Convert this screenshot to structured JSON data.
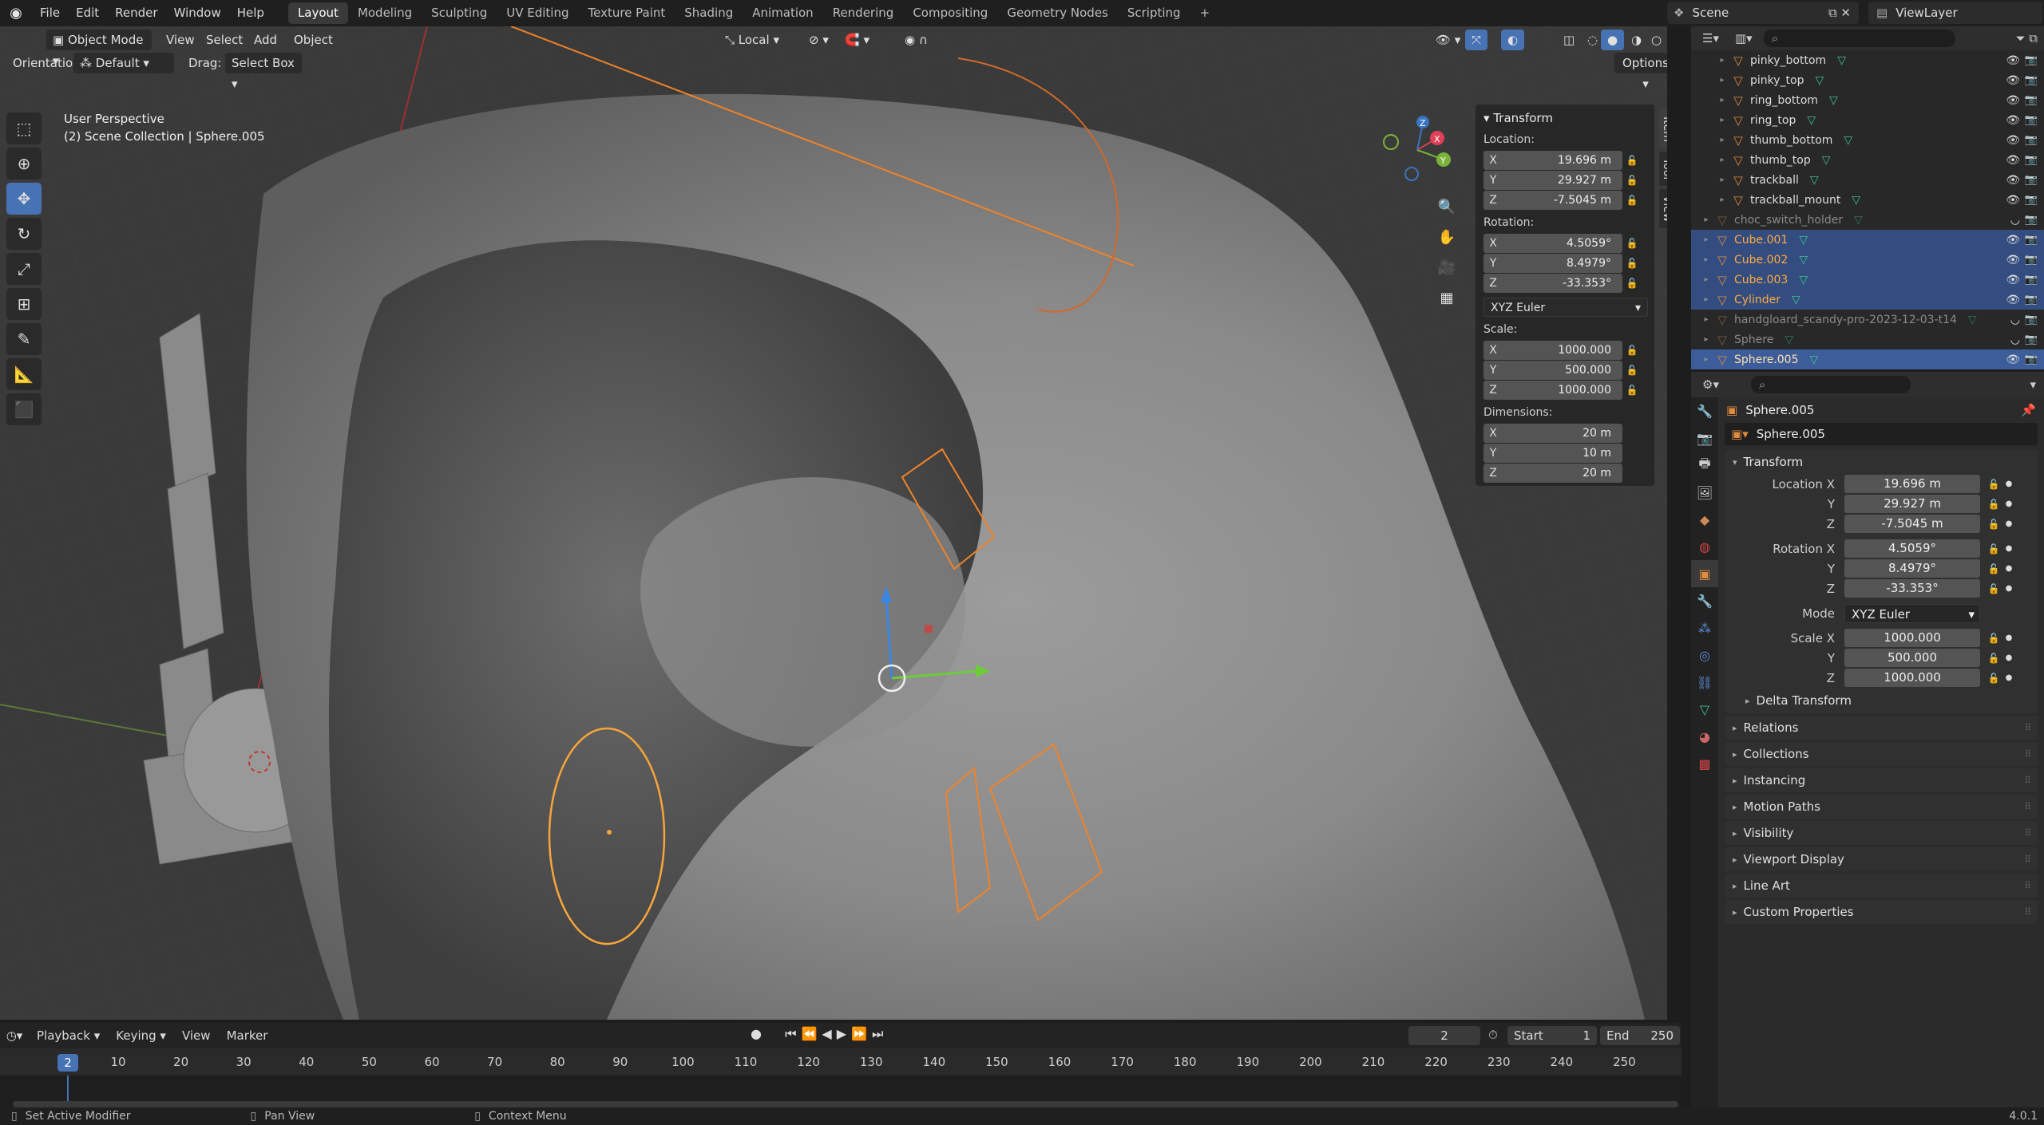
{
  "menu": [
    "File",
    "Edit",
    "Render",
    "Window",
    "Help"
  ],
  "workspaces": [
    "Layout",
    "Modeling",
    "Sculpting",
    "UV Editing",
    "Texture Paint",
    "Shading",
    "Animation",
    "Rendering",
    "Compositing",
    "Geometry Nodes",
    "Scripting"
  ],
  "active_workspace": "Layout",
  "add_workspace_icon": "+",
  "scene": "Scene",
  "view_layer": "ViewLayer",
  "viewport": {
    "mode": "Object Mode",
    "menus": [
      "View",
      "Select",
      "Add",
      "Object"
    ],
    "orientation_label": "Orientation:",
    "orientation_value": "Default",
    "drag_label": "Drag:",
    "drag_value": "Select Box",
    "transform_space": "Local",
    "options": "Options",
    "perspective": "User Perspective",
    "collection_path": "(2) Scene Collection | Sphere.005",
    "gizmo_axes": {
      "x": "X",
      "y": "Y",
      "z": "Z"
    }
  },
  "npanel": {
    "header": "Transform",
    "location_label": "Location:",
    "location": [
      {
        "axis": "X",
        "value": "19.696 m"
      },
      {
        "axis": "Y",
        "value": "29.927 m"
      },
      {
        "axis": "Z",
        "value": "-7.5045 m"
      }
    ],
    "rotation_label": "Rotation:",
    "rotation": [
      {
        "axis": "X",
        "value": "4.5059°"
      },
      {
        "axis": "Y",
        "value": "8.4979°"
      },
      {
        "axis": "Z",
        "value": "-33.353°"
      }
    ],
    "rotation_mode": "XYZ Euler",
    "scale_label": "Scale:",
    "scale": [
      {
        "axis": "X",
        "value": "1000.000"
      },
      {
        "axis": "Y",
        "value": "500.000"
      },
      {
        "axis": "Z",
        "value": "1000.000"
      }
    ],
    "dimensions_label": "Dimensions:",
    "dimensions": [
      {
        "axis": "X",
        "value": "20 m"
      },
      {
        "axis": "Y",
        "value": "10 m"
      },
      {
        "axis": "Z",
        "value": "20 m"
      }
    ],
    "tabs": [
      "Item",
      "Tool",
      "View"
    ]
  },
  "timeline": {
    "menus": [
      "Playback",
      "Keying",
      "View",
      "Marker"
    ],
    "current_frame": "2",
    "start_label": "Start",
    "start": "1",
    "end_label": "End",
    "end": "250",
    "ticks": [
      "10",
      "20",
      "30",
      "40",
      "50",
      "60",
      "70",
      "80",
      "90",
      "100",
      "110",
      "120",
      "130",
      "140",
      "150",
      "160",
      "170",
      "180",
      "190",
      "200",
      "210",
      "220",
      "230",
      "240",
      "250"
    ]
  },
  "status": {
    "left": "Set Active Modifier",
    "middle": "Pan View",
    "right": "Context Menu",
    "version": "4.0.1"
  },
  "outliner": [
    {
      "name": "pinky_bottom",
      "indent": 2,
      "state": "normal"
    },
    {
      "name": "pinky_top",
      "indent": 2,
      "state": "normal"
    },
    {
      "name": "ring_bottom",
      "indent": 2,
      "state": "normal"
    },
    {
      "name": "ring_top",
      "indent": 2,
      "state": "normal"
    },
    {
      "name": "thumb_bottom",
      "indent": 2,
      "state": "normal"
    },
    {
      "name": "thumb_top",
      "indent": 2,
      "state": "normal"
    },
    {
      "name": "trackball",
      "indent": 2,
      "state": "normal"
    },
    {
      "name": "trackball_mount",
      "indent": 2,
      "state": "normal"
    },
    {
      "name": "choc_switch_holder",
      "indent": 1,
      "state": "dim"
    },
    {
      "name": "Cube.001",
      "indent": 1,
      "state": "selected"
    },
    {
      "name": "Cube.002",
      "indent": 1,
      "state": "selected"
    },
    {
      "name": "Cube.003",
      "indent": 1,
      "state": "selected"
    },
    {
      "name": "Cylinder",
      "indent": 1,
      "state": "selected"
    },
    {
      "name": "handgloard_scandy-pro-2023-12-03-t14",
      "indent": 1,
      "state": "dim"
    },
    {
      "name": "Sphere",
      "indent": 1,
      "state": "dim"
    },
    {
      "name": "Sphere.005",
      "indent": 1,
      "state": "active"
    }
  ],
  "properties": {
    "object_name": "Sphere.005",
    "datablock_name": "Sphere.005",
    "transform_header": "Transform",
    "location_x_label": "Location X",
    "rotation_x_label": "Rotation X",
    "scale_x_label": "Scale X",
    "y_label": "Y",
    "z_label": "Z",
    "mode_label": "Mode",
    "location": [
      "19.696 m",
      "29.927 m",
      "-7.5045 m"
    ],
    "rotation": [
      "4.5059°",
      "8.4979°",
      "-33.353°"
    ],
    "mode": "XYZ Euler",
    "scale": [
      "1000.000",
      "500.000",
      "1000.000"
    ],
    "delta_transform": "Delta Transform",
    "collapsed_panels": [
      "Relations",
      "Collections",
      "Instancing",
      "Motion Paths",
      "Visibility",
      "Viewport Display",
      "Line Art",
      "Custom Properties"
    ]
  },
  "colors": {
    "accent": "#4772b3",
    "selected_text": "#ffaa40",
    "object_orange": "#e08a3c",
    "outline_orange": "#f0832a",
    "mesh_green": "#3ec28a"
  }
}
